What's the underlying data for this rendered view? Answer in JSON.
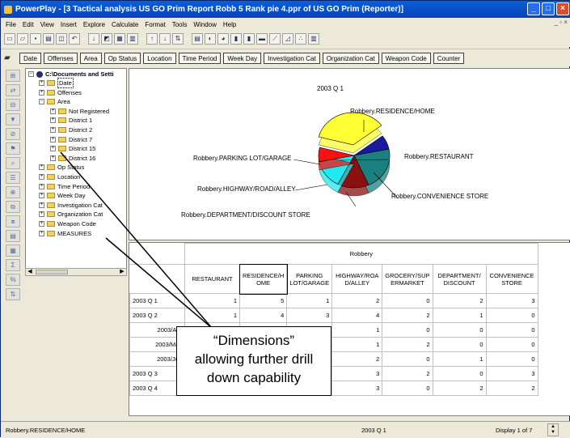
{
  "window": {
    "title": "PowerPlay - [3 Tactical analysis US GO Prim Report Robb 5 Rank pie 4.ppr of US GO Prim (Reporter)]"
  },
  "menubar": {
    "items": [
      "File",
      "Edit",
      "View",
      "Insert",
      "Explore",
      "Calculate",
      "Format",
      "Tools",
      "Window",
      "Help"
    ]
  },
  "dimension_bar": {
    "buttons": [
      "Date",
      "Offenses",
      "Area",
      "Op Status",
      "Location",
      "Time Period",
      "Week Day",
      "Investigation Cat",
      "Organization Cat",
      "Weapon Code",
      "Counter"
    ]
  },
  "tree": {
    "root": "C:\\Documents and Setti",
    "items": [
      {
        "label": "Date",
        "level": 1,
        "expanded": false,
        "selected": true
      },
      {
        "label": "Offenses",
        "level": 1,
        "expanded": false
      },
      {
        "label": "Area",
        "level": 1,
        "expanded": true
      },
      {
        "label": "Not Registered",
        "level": 2,
        "expanded": false
      },
      {
        "label": "District 1",
        "level": 2,
        "expanded": false
      },
      {
        "label": "District 2",
        "level": 2,
        "expanded": false
      },
      {
        "label": "District 7",
        "level": 2,
        "expanded": false
      },
      {
        "label": "District 15",
        "level": 2,
        "expanded": false
      },
      {
        "label": "District 16",
        "level": 2,
        "expanded": false
      },
      {
        "label": "Op Status",
        "level": 1,
        "expanded": false
      },
      {
        "label": "Location",
        "level": 1,
        "expanded": false
      },
      {
        "label": "Time Period",
        "level": 1,
        "expanded": false
      },
      {
        "label": "Week Day",
        "level": 1,
        "expanded": false
      },
      {
        "label": "Investigation Cat",
        "level": 1,
        "expanded": false
      },
      {
        "label": "Organization Cat",
        "level": 1,
        "expanded": false
      },
      {
        "label": "Weapon Code",
        "level": 1,
        "expanded": false
      },
      {
        "label": "MEASURES",
        "level": 1,
        "expanded": false
      }
    ]
  },
  "chart_data": {
    "type": "pie",
    "title": "2003 Q 1",
    "slices": [
      {
        "label": "Robbery.RESIDENCE/HOME",
        "value": 5,
        "color": "#ffff33"
      },
      {
        "label": "Robbery.RESTAURANT",
        "value": 1,
        "color": "#1a1aa0"
      },
      {
        "label": "Robbery.CONVENIENCE STORE",
        "value": 3,
        "color": "#1a8080"
      },
      {
        "label": "Robbery.DEPARTMENT/DISCOUNT STORE",
        "value": 2,
        "color": "#8b1010"
      },
      {
        "label": "Robbery.HIGHWAY/ROAD/ALLEY",
        "value": 2,
        "color": "#22e8f0"
      },
      {
        "label": "Robbery.PARKING LOT/GARAGE",
        "value": 1,
        "color": "#ff1010"
      }
    ]
  },
  "grid": {
    "group_header": "Robbery",
    "columns": [
      "RESTAURANT",
      "RESIDENCE/HOME",
      "PARKING LOT/GARAGE",
      "HIGHWAY/ROAD/ALLEY",
      "GROCERY/SUPERMARKET",
      "DEPARTMENT/DISCOUNT",
      "CONVENIENCE STORE"
    ],
    "column_display": [
      "RESTAURANT",
      "RESIDENCE/H\nOME",
      "PARKING\nLOT/GARAGE",
      "HIGHWAY/ROA\nD/ALLEY",
      "GROCERY/SUP\nERMARKET",
      "DEPARTMENT/\nDISCOUNT",
      "CONVENIENCE\nSTORE"
    ],
    "rows": [
      {
        "label": "2003 Q 1",
        "values": [
          "1",
          "5",
          "1",
          "2",
          "0",
          "2",
          "3"
        ]
      },
      {
        "label": "2003 Q 2",
        "values": [
          "1",
          "4",
          "3",
          "4",
          "2",
          "1",
          "0"
        ]
      },
      {
        "label": "2003/Apr",
        "values": [
          "",
          "",
          "1",
          "1",
          "0",
          "0",
          "0"
        ]
      },
      {
        "label": "2003/May",
        "values": [
          "",
          "",
          "1",
          "1",
          "2",
          "0",
          "0"
        ]
      },
      {
        "label": "2003/Jun",
        "values": [
          "",
          "",
          "1",
          "2",
          "0",
          "1",
          "0"
        ]
      },
      {
        "label": "2003 Q 3",
        "values": [
          "",
          "",
          "5",
          "3",
          "2",
          "0",
          "3"
        ]
      },
      {
        "label": "2003 Q 4",
        "values": [
          "",
          "",
          "5",
          "3",
          "0",
          "2",
          "2"
        ]
      }
    ]
  },
  "status": {
    "left": "Robbery.RESIDENCE/HOME",
    "middle": "2003 Q 1",
    "right": "Display 1 of 7"
  },
  "callout": {
    "line1": "“Dimensions”",
    "line2": "allowing further drill",
    "line3": "down capability"
  }
}
